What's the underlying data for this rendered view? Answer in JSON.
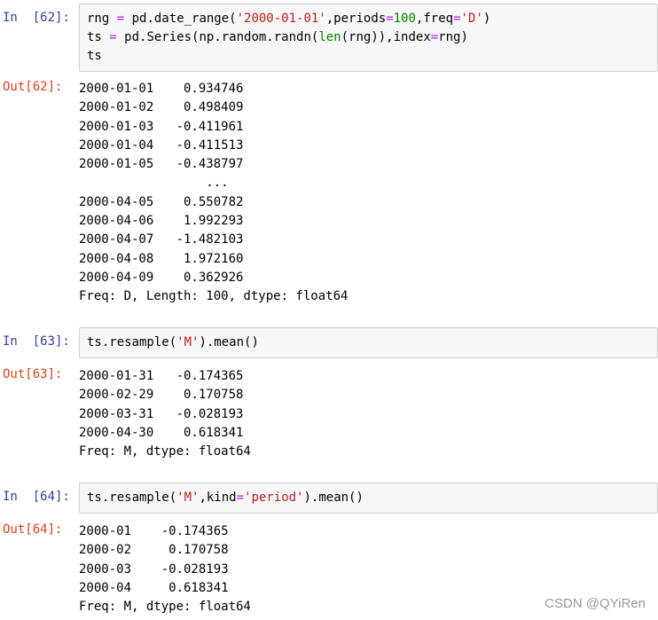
{
  "cells": [
    {
      "in_prompt": "In  [62]:",
      "out_prompt": "Out[62]:",
      "code": [
        [
          {
            "t": "rng "
          },
          {
            "t": "=",
            "c": "op"
          },
          {
            "t": " pd.date_range("
          },
          {
            "t": "'2000-01-01'",
            "c": "str"
          },
          {
            "t": ",periods"
          },
          {
            "t": "=",
            "c": "op"
          },
          {
            "t": "100",
            "c": "num"
          },
          {
            "t": ",freq"
          },
          {
            "t": "=",
            "c": "op"
          },
          {
            "t": "'D'",
            "c": "str"
          },
          {
            "t": ")"
          }
        ],
        [
          {
            "t": "ts "
          },
          {
            "t": "=",
            "c": "op"
          },
          {
            "t": " pd.Series(np.random.randn("
          },
          {
            "t": "len",
            "c": "fn"
          },
          {
            "t": "(rng)),index"
          },
          {
            "t": "=",
            "c": "op"
          },
          {
            "t": "rng)"
          }
        ],
        [
          {
            "t": "ts"
          }
        ]
      ],
      "output": [
        "2000-01-01    0.934746",
        "2000-01-02    0.498409",
        "2000-01-03   -0.411961",
        "2000-01-04   -0.411513",
        "2000-01-05   -0.438797",
        "                 ...",
        "2000-04-05    0.550782",
        "2000-04-06    1.992293",
        "2000-04-07   -1.482103",
        "2000-04-08    1.972160",
        "2000-04-09    0.362926",
        "Freq: D, Length: 100, dtype: float64"
      ]
    },
    {
      "in_prompt": "In  [63]:",
      "out_prompt": "Out[63]:",
      "code": [
        [
          {
            "t": "ts.resample("
          },
          {
            "t": "'M'",
            "c": "str"
          },
          {
            "t": ").mean()"
          }
        ]
      ],
      "output": [
        "2000-01-31   -0.174365",
        "2000-02-29    0.170758",
        "2000-03-31   -0.028193",
        "2000-04-30    0.618341",
        "Freq: M, dtype: float64"
      ]
    },
    {
      "in_prompt": "In  [64]:",
      "out_prompt": "Out[64]:",
      "code": [
        [
          {
            "t": "ts.resample("
          },
          {
            "t": "'M'",
            "c": "str"
          },
          {
            "t": ",kind"
          },
          {
            "t": "=",
            "c": "op"
          },
          {
            "t": "'period'",
            "c": "str"
          },
          {
            "t": ").mean()"
          }
        ]
      ],
      "output": [
        "2000-01    -0.174365",
        "2000-02     0.170758",
        "2000-03    -0.028193",
        "2000-04     0.618341",
        "Freq: M, dtype: float64"
      ]
    }
  ],
  "watermark": "CSDN @QYiRen"
}
